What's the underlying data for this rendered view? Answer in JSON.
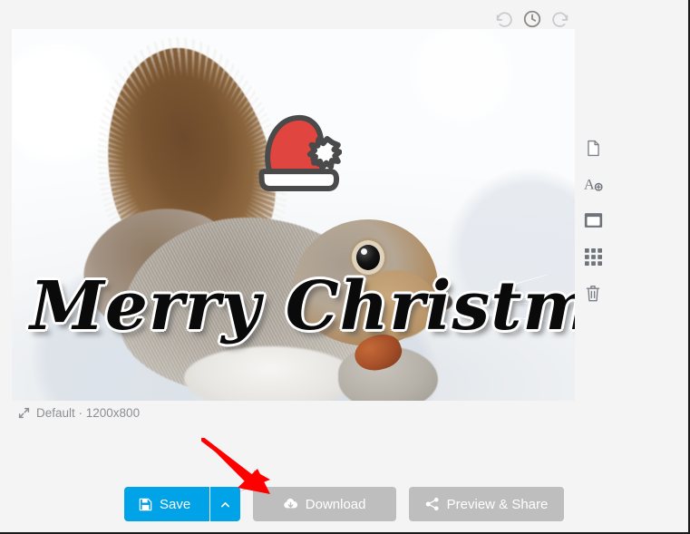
{
  "app": {
    "background_color": "#f4f4f5",
    "accent_color": "#00a2e8",
    "muted_button_color": "#bebebe",
    "annotation_color": "#ff0000"
  },
  "top_toolbar": {
    "items": [
      {
        "name": "undo",
        "icon": "undo-icon",
        "label": "Undo",
        "state": "enabled"
      },
      {
        "name": "history",
        "icon": "history-clock-icon",
        "label": "History",
        "state": "active"
      },
      {
        "name": "redo",
        "icon": "redo-icon",
        "label": "Redo",
        "state": "enabled"
      }
    ]
  },
  "canvas": {
    "image_alt": "Gray squirrel eating a nut in the snow",
    "stickers": [
      {
        "name": "santa-hat",
        "label": "Santa Hat",
        "fill": "#e0453f",
        "brim": "#ffffff",
        "outline": "#4a4a4a"
      }
    ],
    "text_layers": [
      {
        "name": "greeting",
        "text": "Merry Christmas",
        "color": "#0a0a0a",
        "outline_color": "#ffffff"
      }
    ],
    "meta": {
      "icon": "resize-arrows-icon",
      "preset": "Default",
      "separator": "·",
      "dimensions": "1200x800",
      "full_label": "Default · 1200x800"
    }
  },
  "tool_rail": {
    "items": [
      {
        "name": "page",
        "icon": "document-icon",
        "label": "Canvas"
      },
      {
        "name": "add-text",
        "icon": "add-text-icon",
        "label": "Add Text"
      },
      {
        "name": "frame",
        "icon": "frame-icon",
        "label": "Frame"
      },
      {
        "name": "stickers",
        "icon": "grid-icon",
        "label": "Stickers"
      },
      {
        "name": "delete",
        "icon": "trash-icon",
        "label": "Delete"
      }
    ]
  },
  "action_bar": {
    "save": {
      "label": "Save",
      "icon": "floppy-disk-icon",
      "color": "#00a2e8"
    },
    "save_caret": {
      "icon": "chevron-up-icon",
      "label": "More save options"
    },
    "download": {
      "label": "Download",
      "icon": "cloud-download-icon",
      "color": "#bebebe"
    },
    "share": {
      "label": "Preview & Share",
      "icon": "share-nodes-icon",
      "color": "#bebebe"
    }
  },
  "annotation": {
    "arrow": {
      "name": "red-arrow",
      "points_to": "save-button",
      "color": "#ff0000"
    }
  }
}
